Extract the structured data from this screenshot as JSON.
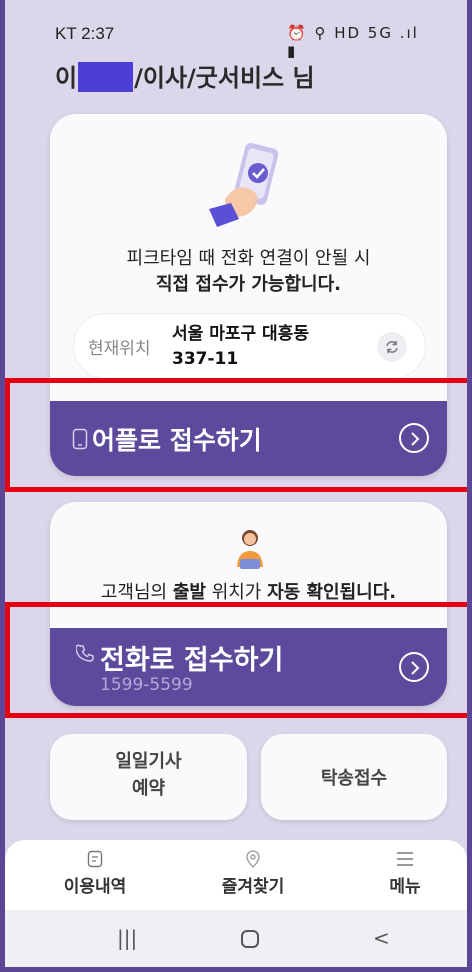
{
  "status_bar": {
    "carrier_time": "KT 2:37",
    "icons": "⏰ ⚲ HD 5G .ıl ▮"
  },
  "header": {
    "title_prefix": "이",
    "title_suffix": "/이사/굿서비스 님"
  },
  "app_card": {
    "line1": "피크타임 때 전화 연결이 안될 시",
    "line2": "직접 접수가 가능합니다.",
    "location_label": "현재위치",
    "address_line1": "서울 마포구 대흥동",
    "address_line2": "337-11",
    "button_label": "어플로 접수하기"
  },
  "phone_card": {
    "text_a": "고객님의 ",
    "text_b": "출발",
    "text_c": " 위치가 ",
    "text_d": "자동 확인됩니다.",
    "button_label": "전화로 접수하기",
    "phone_number": "1599-5599"
  },
  "quick": {
    "reserve_line1": "일일기사",
    "reserve_line2": "예약",
    "consign_label": "탁송접수"
  },
  "tabs": [
    {
      "label": "이용내역",
      "icon": "document-icon"
    },
    {
      "label": "즐겨찾기",
      "icon": "location-pin-icon"
    },
    {
      "label": "메뉴",
      "icon": "hamburger-icon"
    }
  ],
  "nav": {
    "recent": "|||",
    "back": "<"
  },
  "colors": {
    "primary": "#5c4a9c",
    "background": "#dcd6ea",
    "highlight": "#e50012"
  }
}
